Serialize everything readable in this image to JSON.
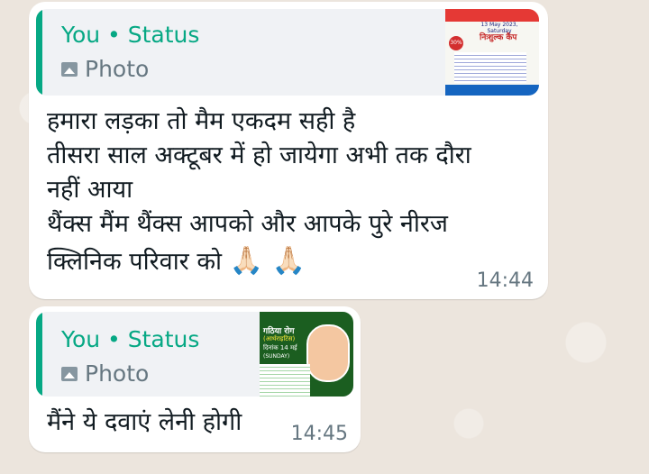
{
  "messages": [
    {
      "quote": {
        "title": "You • Status",
        "type": "Photo"
      },
      "thumb_texts": [
        "निःशुल्क कैंप",
        "13 May 2023, Saturday",
        "30%"
      ],
      "lines": [
        "हमारा लड़का तो मैम एकदम सही है",
        "तीसरा साल अक्टूबर में हो जायेगा अभी तक दौरा",
        "नहीं आया",
        "थैंक्स मैंम थैंक्स आपको और आपके पुरे नीरज",
        "क्लिनिक परिवार को"
      ],
      "emoji": "🙏🏻 🙏🏻",
      "time": "14:44"
    },
    {
      "quote": {
        "title": "You • Status",
        "type": "Photo"
      },
      "thumb_texts": [
        "गठिया रोग",
        "(आर्थराइटिस)",
        "दिनांक 14 मई",
        "(SUNDAY)"
      ],
      "lines": [
        "मैंने ये दवाएं लेनी होगी"
      ],
      "time": "14:45"
    }
  ],
  "colors": {
    "accent": "#06a884",
    "bubble": "#ffffff",
    "quote_bg": "#f0f2f5",
    "chat_bg": "#ece5dd"
  }
}
